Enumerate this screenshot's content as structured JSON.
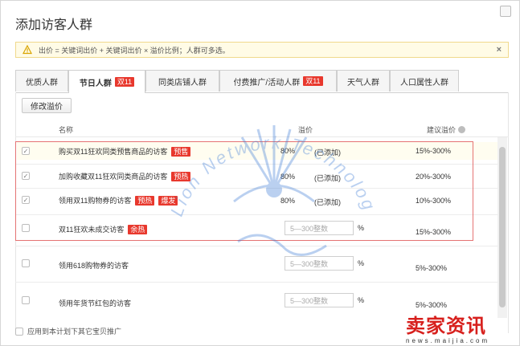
{
  "dialog": {
    "title": "添加访客人群",
    "notice": "出价 = 关键词出价 + 关键词出价 × 溢价比例；人群可多选。",
    "notice_close": "×"
  },
  "tabs": [
    {
      "label": "优质人群",
      "tag": ""
    },
    {
      "label": "节日人群",
      "tag": "双11"
    },
    {
      "label": "同类店铺人群",
      "tag": ""
    },
    {
      "label": "付费推广/活动人群",
      "tag": "双11"
    },
    {
      "label": "天气人群",
      "tag": ""
    },
    {
      "label": "人口属性人群",
      "tag": ""
    }
  ],
  "toolbar": {
    "edit_premium": "修改溢价"
  },
  "table": {
    "headers": {
      "name": "名称",
      "premium": "溢价",
      "suggest": "建议溢价"
    },
    "rows": [
      {
        "checked": true,
        "name": "购买双11狂欢同类预售商品的访客",
        "tags": [
          "预售"
        ],
        "premium": "80%",
        "status": "(已添加)",
        "placeholder": "",
        "pct": "",
        "suggest": "15%-300%"
      },
      {
        "checked": true,
        "name": "加购收藏双11狂欢同类商品的访客",
        "tags": [
          "预热"
        ],
        "premium": "80%",
        "status": "(已添加)",
        "placeholder": "",
        "pct": "",
        "suggest": "20%-300%"
      },
      {
        "checked": true,
        "name": "领用双11购物券的访客",
        "tags": [
          "预热",
          "爆发"
        ],
        "premium": "80%",
        "status": "(已添加)",
        "placeholder": "",
        "pct": "",
        "suggest": "10%-300%"
      },
      {
        "checked": false,
        "name": "双11狂欢未成交访客",
        "tags": [
          "余热"
        ],
        "premium": "",
        "status": "",
        "placeholder": "5—300整数",
        "pct": "%",
        "suggest": "15%-300%"
      },
      {
        "checked": false,
        "name": "领用618购物券的访客",
        "tags": [],
        "premium": "",
        "status": "",
        "placeholder": "5—300整数",
        "pct": "%",
        "suggest": "5%-300%"
      },
      {
        "checked": false,
        "name": "领用年货节红包的访客",
        "tags": [],
        "premium": "",
        "status": "",
        "placeholder": "5—300整数",
        "pct": "%",
        "suggest": "5%-300%"
      }
    ]
  },
  "footer": {
    "apply_label": "应用到本计划下其它宝贝推广"
  },
  "watermark": {
    "text": "Lion Network Technology",
    "corner_cn": "卖家资讯",
    "corner_url": "news.maijia.com"
  },
  "colors": {
    "accent_red": "#e8382d",
    "select_border": "#e57373",
    "notice_bg": "#fffbe6"
  }
}
